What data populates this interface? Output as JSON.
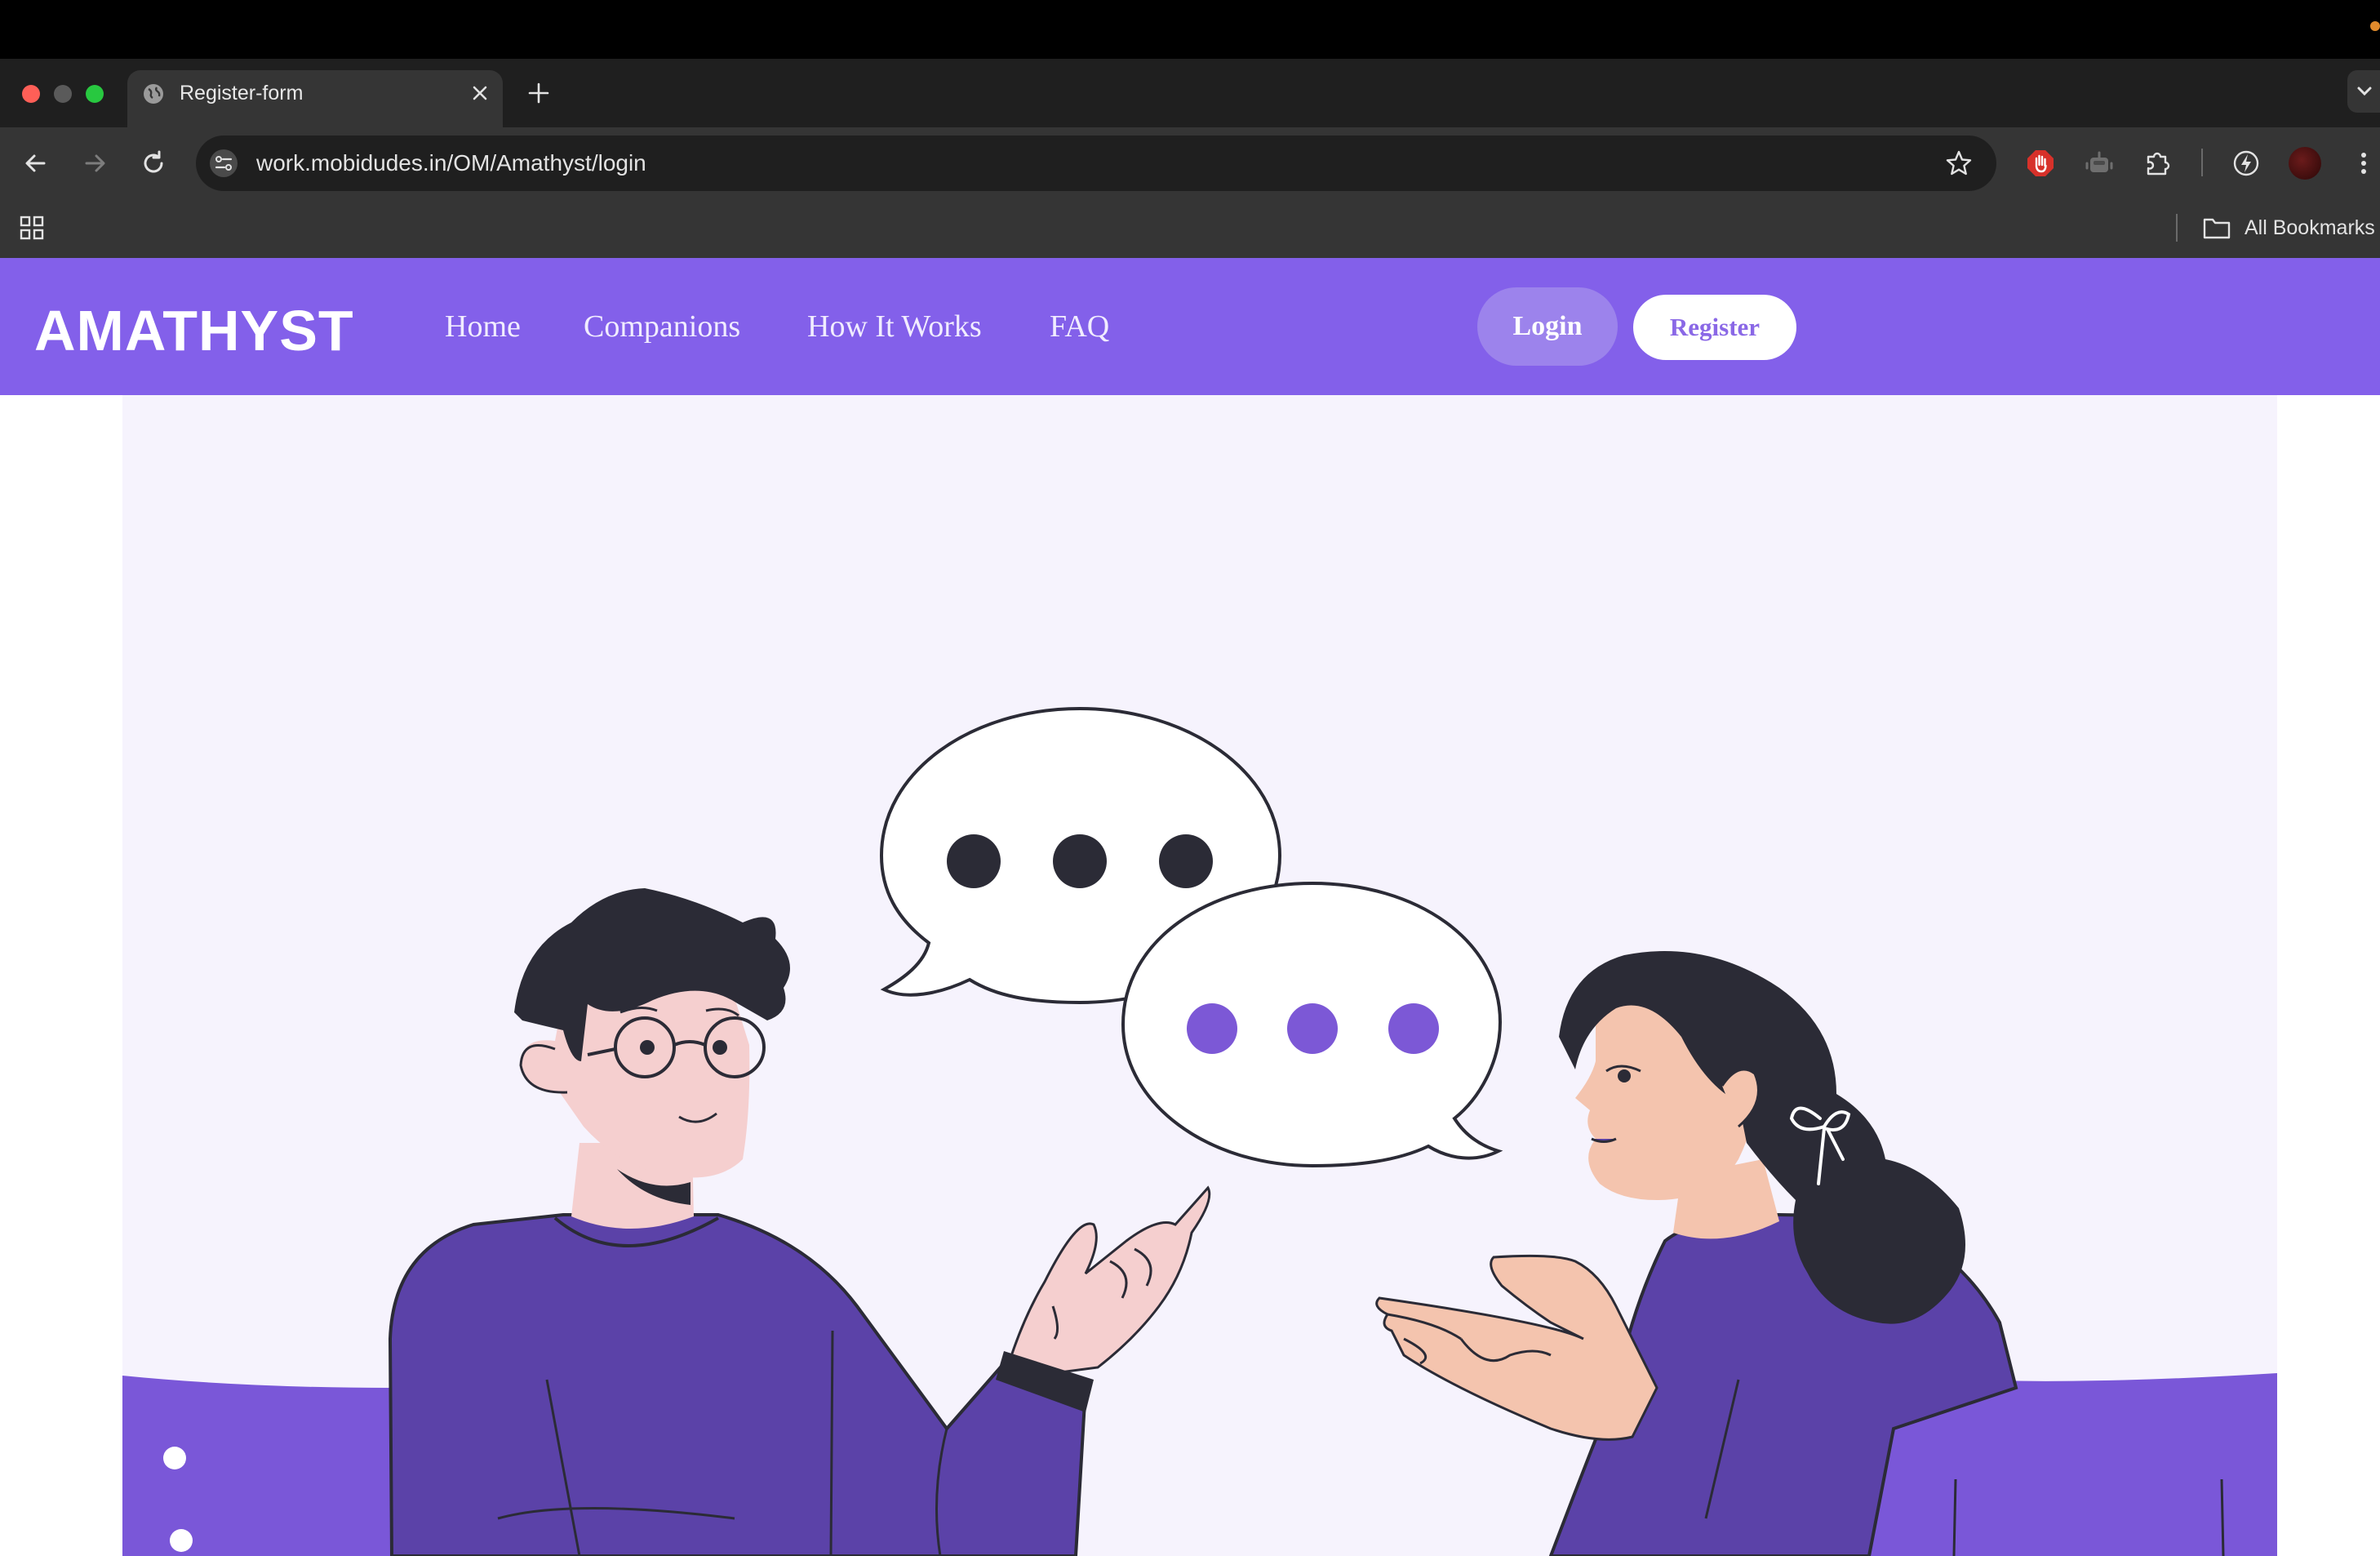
{
  "browser": {
    "tab_title": "Register-form",
    "url": "work.mobidudes.in/OM/Amathyst/login",
    "bookmarks_label": "All Bookmarks"
  },
  "site": {
    "logo_text": "AMATHYST",
    "nav": [
      {
        "label": "Home"
      },
      {
        "label": "Companions"
      },
      {
        "label": "How It Works"
      },
      {
        "label": "FAQ"
      }
    ],
    "login_label": "Login",
    "register_label": "Register"
  },
  "colors": {
    "brand_purple": "#8360ea",
    "hero_background": "#f6f3fd",
    "shirt_purple": "#5b42a8",
    "chair_purple": "#7a57d8",
    "chat_dot_purple": "#7c58d6"
  },
  "icons": [
    "globe-icon",
    "close-icon",
    "plus-icon",
    "chevron-down-icon",
    "back-arrow-icon",
    "forward-arrow-icon",
    "reload-icon",
    "site-info-icon",
    "star-icon",
    "stop-hand-icon",
    "robot-icon",
    "puzzle-icon",
    "bolt-icon",
    "kebab-menu-icon",
    "apps-grid-icon",
    "folder-icon"
  ]
}
